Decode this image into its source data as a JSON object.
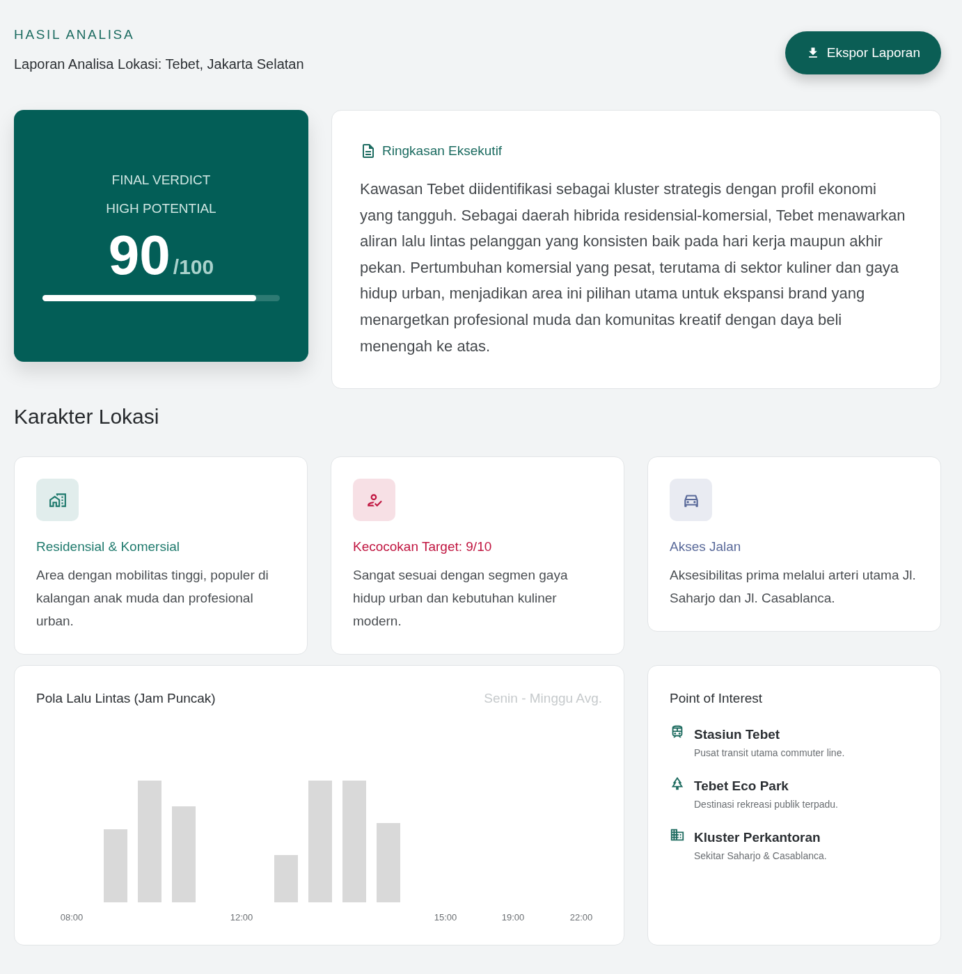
{
  "header": {
    "eyebrow": "HASIL ANALISA",
    "subtitle": "Laporan Analisa Lokasi: Tebet, Jakarta Selatan",
    "export_button": "Ekspor Laporan"
  },
  "verdict": {
    "label": "FINAL VERDICT",
    "status": "HIGH POTENTIAL",
    "score": "90",
    "max": "/100",
    "level": 0.9
  },
  "summary": {
    "title": "Ringkasan Eksekutif",
    "text": "Kawasan Tebet diidentifikasi sebagai kluster strategis dengan profil ekonomi yang tangguh. Sebagai daerah hibrida residensial-komersial, Tebet menawarkan aliran lalu lintas pelanggan yang konsisten baik pada hari kerja maupun akhir pekan. Pertumbuhan komersial yang pesat, terutama di sektor kuliner dan gaya hidup urban, menjadikan area ini pilihan utama untuk ekspansi brand yang menargetkan profesional muda dan komunitas kreatif dengan daya beli menengah ke atas."
  },
  "section_title": "Karakter Lokasi",
  "features": [
    {
      "title": "Residensial & Komersial",
      "description": "Area dengan mobilitas tinggi, populer di kalangan anak muda dan profesional urban.",
      "color": "#1f7a6d"
    },
    {
      "title": "Kecocokan Target: 9/10",
      "description": "Sangat sesuai dengan segmen gaya hidup urban dan kebutuhan kuliner modern.",
      "color": "#c0143f"
    },
    {
      "title": "Akses Jalan",
      "description": "Aksesibilitas prima melalui arteri utama Jl. Saharjo dan Jl. Casablanca.",
      "color": "#5a6a9a"
    }
  ],
  "traffic": {
    "title": "Pola Lalu Lintas (Jam Puncak)",
    "note": "Senin - Minggu Avg.",
    "x_labels": [
      "08:00",
      "12:00",
      "15:00",
      "19:00",
      "22:00"
    ]
  },
  "poi": {
    "title": "Point of Interest",
    "items": [
      {
        "name": "Stasiun Tebet",
        "description": "Pusat transit utama commuter line."
      },
      {
        "name": "Tebet Eco Park",
        "description": "Destinasi rekreasi publik terpadu."
      },
      {
        "name": "Kluster Perkantoran",
        "description": "Sekitar Saharjo & Casablanca."
      }
    ]
  }
}
